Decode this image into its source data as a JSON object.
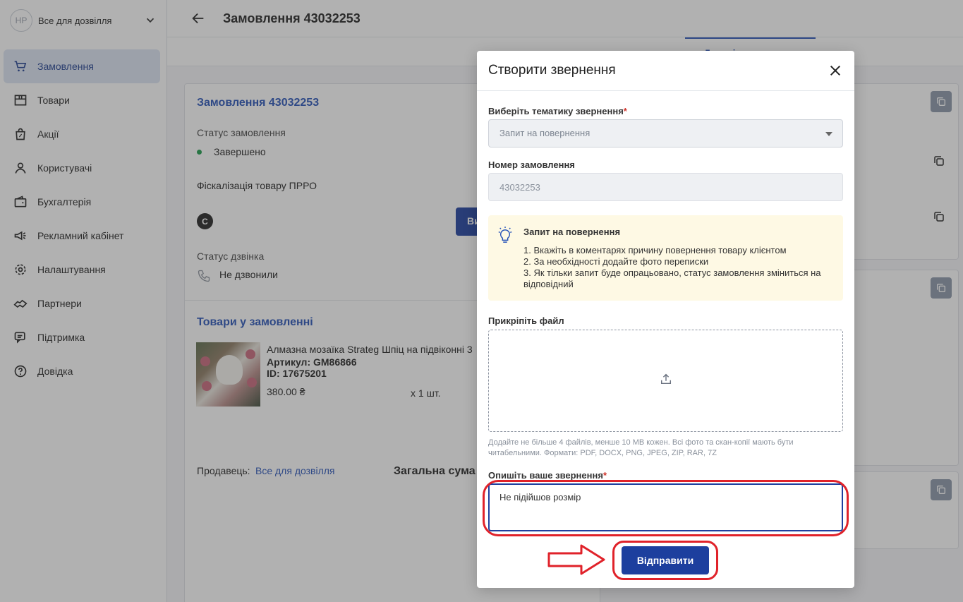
{
  "sidebar": {
    "avatar_initials": "HP",
    "shop_name": "Все для дозвілля",
    "items": [
      {
        "label": "Замовлення",
        "icon": "cart-icon",
        "active": true
      },
      {
        "label": "Товари",
        "icon": "box-icon"
      },
      {
        "label": "Акції",
        "icon": "promo-bag-icon"
      },
      {
        "label": "Користувачі",
        "icon": "user-icon"
      },
      {
        "label": "Бухгалтерія",
        "icon": "wallet-icon"
      },
      {
        "label": "Рекламний кабінет",
        "icon": "megaphone-icon"
      },
      {
        "label": "Налаштування",
        "icon": "gear-icon"
      },
      {
        "label": "Партнери",
        "icon": "handshake-icon"
      },
      {
        "label": "Підтримка",
        "icon": "chat-icon"
      },
      {
        "label": "Довідка",
        "icon": "help-icon"
      }
    ]
  },
  "header": {
    "title": "Замовлення 43032253",
    "active_tab": "Деталі замовлення"
  },
  "order": {
    "title": "Замовлення 43032253",
    "status_label": "Статус замовлення",
    "status_value": "Завершено",
    "fiscal_label": "Фіскалізація товару ПРРО",
    "fiscal_badge": "С",
    "button_partial": "Ви",
    "call_status_label": "Статус дзвінка",
    "call_status_value": "Не дзвонили",
    "products_title": "Товари у замовленні",
    "product": {
      "name": "Алмазна мозаїка Strateg Шпіц на підвіконні 3",
      "article": "Артикул: GM86866",
      "id": "ID: 17675201",
      "price": "380.00 ₴",
      "qty": "x 1 шт."
    },
    "seller_label": "Продавець:",
    "seller_value": "Все для дозвілля",
    "total_label": "Загальна сума з"
  },
  "modal": {
    "title": "Створити звернення",
    "topic_label": "Виберіть тематику звернення",
    "topic_value": "Запит на повернення",
    "order_number_label": "Номер замовлення",
    "order_number_value": "43032253",
    "info_title": "Запит на повернення",
    "info_items": [
      "1. Вкажіть в коментарях причину повернення товару клієнтом",
      "2. За необхідності додайте фото переписки",
      "3. Як тільки запит буде опрацьовано, статус замовлення зміниться на відповідний"
    ],
    "attach_label": "Прикріпіть файл",
    "attach_hint": "Додайте не більше 4 файлів, менше 10 MB кожен. Всі фото та скан-копії мають бути читабельними. Формати: PDF, DOCX, PNG, JPEG, ZIP, RAR, 7Z",
    "message_label": "Опишіть ваше звернення",
    "message_value": "Не підійшов розмір",
    "submit_label": "Відправити",
    "required_mark": "*"
  }
}
